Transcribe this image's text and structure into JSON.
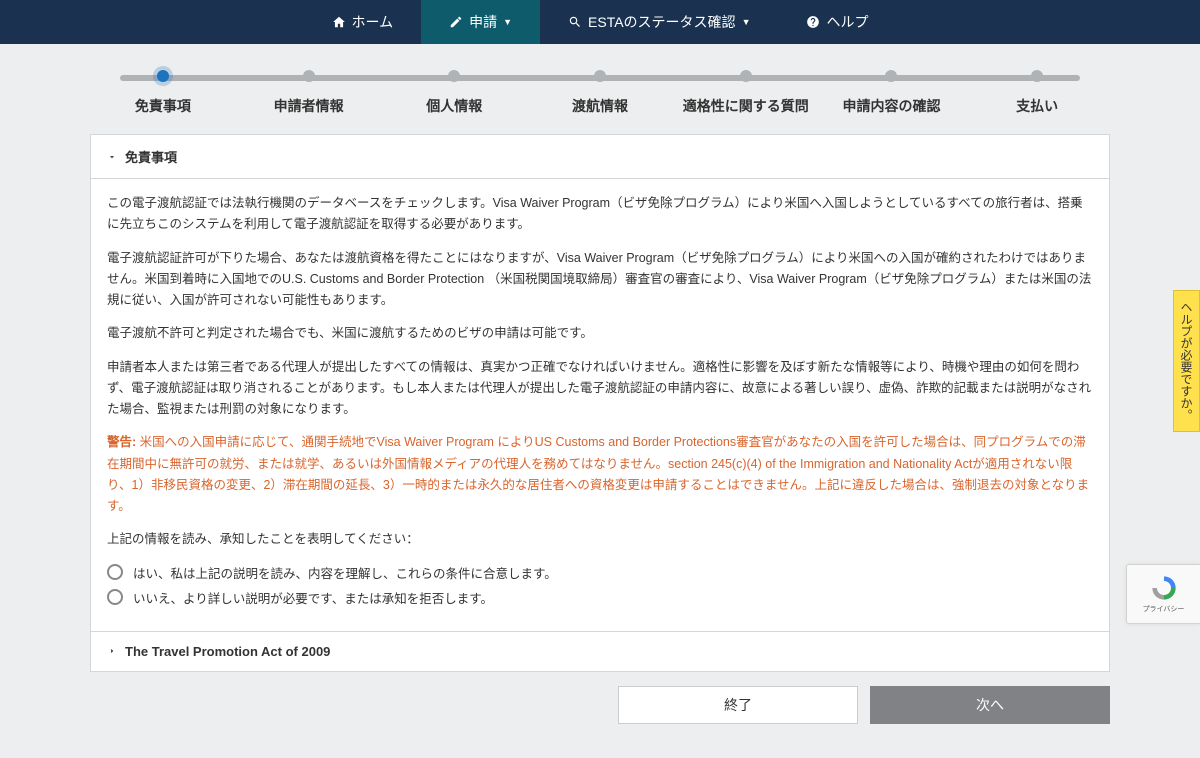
{
  "nav": {
    "home": "ホーム",
    "apply": "申請",
    "status": "ESTAのステータス確認",
    "help": "ヘルプ"
  },
  "steps": [
    "免責事項",
    "申請者情報",
    "個人情報",
    "渡航情報",
    "適格性に関する質問",
    "申請内容の確認",
    "支払い"
  ],
  "panel1": {
    "title": "免責事項",
    "p1": "この電子渡航認証では法執行機関のデータベースをチェックします。Visa Waiver Program（ビザ免除プログラム）により米国へ入国しようとしているすべての旅行者は、搭乗に先立ちこのシステムを利用して電子渡航認証を取得する必要があります。",
    "p2": "電子渡航認証許可が下りた場合、あなたは渡航資格を得たことにはなりますが、Visa Waiver Program（ビザ免除プログラム）により米国への入国が確約されたわけではありません。米国到着時に入国地でのU.S. Customs and Border Protection （米国税関国境取締局）審査官の審査により、Visa Waiver Program（ビザ免除プログラム）または米国の法規に従い、入国が許可されない可能性もあります。",
    "p3": "電子渡航不許可と判定された場合でも、米国に渡航するためのビザの申請は可能です。",
    "p4": "申請者本人または第三者である代理人が提出したすべての情報は、真実かつ正確でなければいけません。適格性に影響を及ぼす新たな情報等により、時機や理由の如何を問わず、電子渡航認証は取り消されることがあります。もし本人または代理人が提出した電子渡航認証の申請内容に、故意による著しい誤り、虚偽、詐欺的記載または説明がなされた場合、監視または刑罰の対象になります。",
    "warn_label": "警告:",
    "warn_text": " 米国への入国申請に応じて、通関手続地でVisa Waiver Program によりUS Customs and Border Protections審査官があなたの入国を許可した場合は、同プログラムでの滞在期間中に無許可の就労、または就学、あるいは外国情報メディアの代理人を務めてはなりません。section 245(c)(4) of the Immigration and Nationality Actが適用されない限り、1）非移民資格の変更、2）滞在期間の延長、3）一時的または永久的な居住者への資格変更は申請することはできません。上記に違反した場合は、強制退去の対象となります。",
    "confirm": "上記の情報を読み、承知したことを表明してください：",
    "opt_yes": "はい、私は上記の説明を読み、内容を理解し、これらの条件に合意します。",
    "opt_no": "いいえ、より詳しい説明が必要です、または承知を拒否します。"
  },
  "panel2": {
    "title": "The Travel Promotion Act of 2009"
  },
  "buttons": {
    "exit": "終了",
    "next": "次へ"
  },
  "sidebar": {
    "help": "ヘルプが必要ですか。"
  },
  "recaptcha": {
    "privacy": "プライバシー"
  }
}
